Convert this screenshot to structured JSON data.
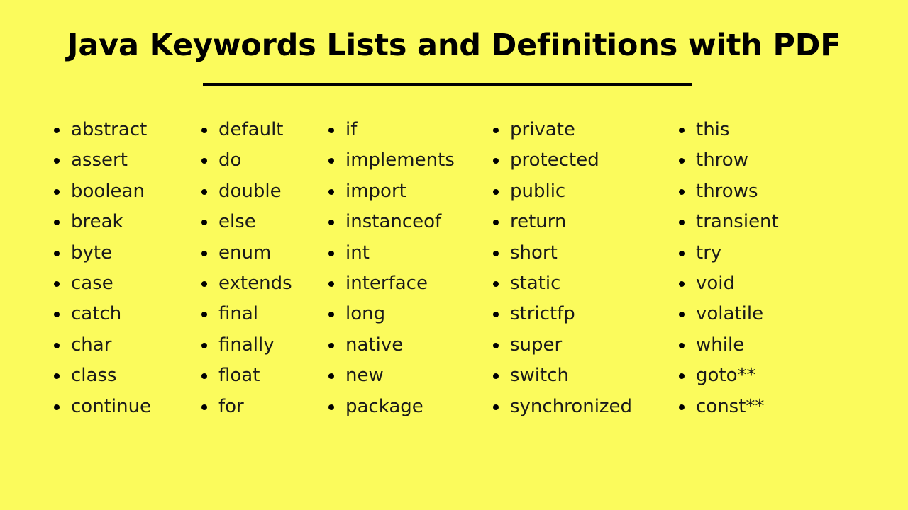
{
  "page": {
    "background_color": "#FBFB5C",
    "text_color": "#1a1a1a",
    "title": "Java Keywords Lists and Definitions with PDF",
    "divider": "title-underline-rule"
  },
  "keyword_columns": [
    {
      "id": "column-1",
      "items": [
        "abstract",
        "assert",
        "boolean",
        "break",
        "byte",
        "case",
        "catch",
        "char",
        "class",
        "continue"
      ]
    },
    {
      "id": "column-2",
      "items": [
        "default",
        "do",
        "double",
        "else",
        "enum",
        "extends",
        "final",
        "finally",
        "float",
        "for"
      ]
    },
    {
      "id": "column-3",
      "items": [
        "if",
        "implements",
        "import",
        "instanceof",
        "int",
        "interface",
        "long",
        "native",
        "new",
        "package"
      ]
    },
    {
      "id": "column-4",
      "items": [
        "private",
        "protected",
        "public",
        "return",
        "short",
        "static",
        "strictfp",
        "super",
        "switch",
        "synchronized"
      ]
    },
    {
      "id": "column-5",
      "items": [
        "this",
        "throw",
        "throws",
        "transient",
        "try",
        "void",
        "volatile",
        "while",
        "goto**",
        "const**"
      ]
    }
  ]
}
